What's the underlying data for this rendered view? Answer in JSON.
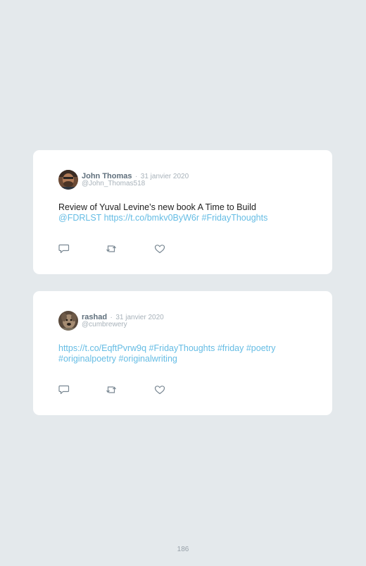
{
  "tweets": [
    {
      "author": "John Thomas",
      "separator": "·",
      "date": "31 janvier 2020",
      "handle": "@John_Thomas518",
      "text": "Review of Yuval Levine’s new book A Time to Build",
      "links": [
        "@FDRLST",
        "https://t.co/bmkv0ByW6r",
        "#FridayThoughts"
      ],
      "avatar_icon": "man-portrait-avatar"
    },
    {
      "author": "rashad",
      "separator": "·",
      "date": "31 janvier 2020",
      "handle": "@cumbrewery",
      "links_line1": [
        "https://t.co/EqftPvrw9q",
        "#FridayThoughts",
        "#friday",
        "#poetry"
      ],
      "links_line2": [
        "#originalpoetry",
        "#originalwriting"
      ],
      "avatar_icon": "dog-portrait-avatar"
    }
  ],
  "actions": {
    "reply_icon": "reply-icon",
    "retweet_icon": "retweet-icon",
    "like_icon": "like-icon"
  },
  "colors": {
    "background": "#e4e9ec",
    "card": "#ffffff",
    "link": "#65bce4",
    "author": "#5f6f7c",
    "muted": "#a8b2ba",
    "icon": "#7a8893"
  },
  "page": {
    "number": "186"
  }
}
